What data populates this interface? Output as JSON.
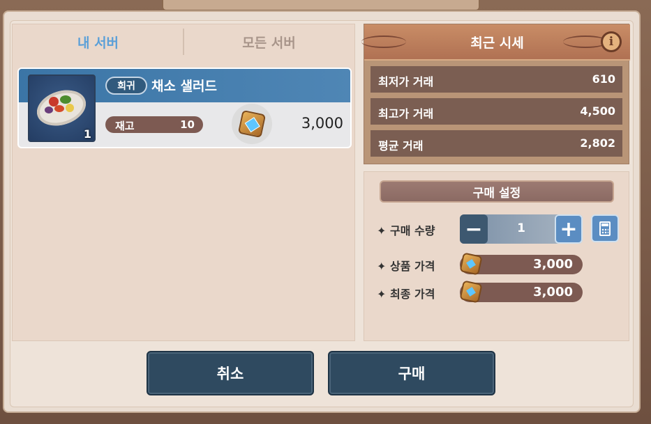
{
  "tabs": {
    "my_server": "내 서버",
    "all_servers": "모든 서버"
  },
  "item": {
    "rarity": "희귀",
    "name": "채소 샐러드",
    "quantity": "1",
    "stock_label": "재고",
    "stock_value": "10",
    "price": "3,000"
  },
  "recent": {
    "title": "최근 시세",
    "info_icon": "i",
    "rows": [
      {
        "label": "최저가 거래",
        "value": "610"
      },
      {
        "label": "최고가 거래",
        "value": "4,500"
      },
      {
        "label": "평균 거래",
        "value": "2,802"
      }
    ]
  },
  "purchase": {
    "title": "구매 설정",
    "quantity_label": "✦ 구매 수량",
    "minus": "−",
    "plus": "+",
    "quantity": "1",
    "item_price_label": "✦ 상품 가격",
    "item_price": "3,000",
    "final_price_label": "✦ 최종 가격",
    "final_price": "3,000"
  },
  "buttons": {
    "cancel": "취소",
    "buy": "구매"
  }
}
